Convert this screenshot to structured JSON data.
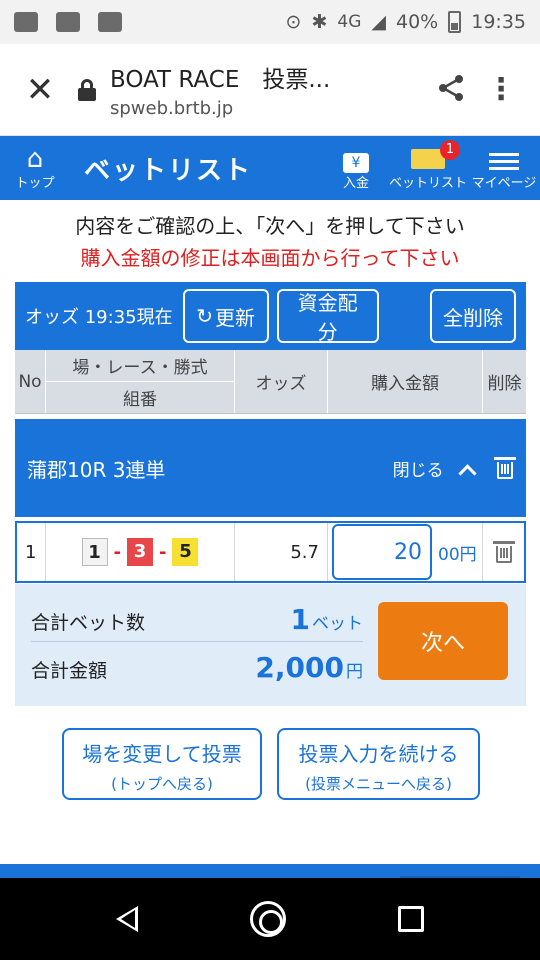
{
  "status_bar": {
    "network": "4G",
    "battery": "40%",
    "time": "19:35"
  },
  "browser": {
    "title": "BOAT RACE　投票...",
    "host": "spweb.brtb.jp",
    "close_icon": "close-icon",
    "share_icon": "share-icon",
    "more_icon": "more-vert-icon"
  },
  "header": {
    "home_label": "トップ",
    "title": "ベットリスト",
    "nav": {
      "deposit": "入金",
      "betlist": "ベットリスト",
      "mypage": "マイページ"
    },
    "badge": "1",
    "accent": "#1a73d8"
  },
  "notices": {
    "line1": "内容をご確認の上、「次へ」を押して下さい",
    "line2": "購入金額の修正は本画面から行って下さい"
  },
  "odds_bar": {
    "label": "オッズ 19:35現在",
    "refresh": "更新",
    "allocate": "資金配分",
    "clear_all": "全削除"
  },
  "table": {
    "headers": {
      "no": "No",
      "venue_line1": "場・レース・勝式",
      "venue_line2": "組番",
      "odds": "オッズ",
      "amount": "購入金額",
      "delete": "削除"
    },
    "race": {
      "name": "蒲郡10R 3連単",
      "close": "閉じる"
    },
    "rows": [
      {
        "no": "1",
        "combo": [
          "1",
          "3",
          "5"
        ],
        "odds": "5.7",
        "amount": "20",
        "unit": "00円"
      }
    ]
  },
  "summary": {
    "bets_label": "合計ベット数",
    "bets_value": "1",
    "bets_unit": "ベット",
    "total_label": "合計金額",
    "total_value": "2,000",
    "total_unit": "円",
    "next": "次へ",
    "next_color": "#ec7c12"
  },
  "bottom_buttons": {
    "change_main": "場を変更して投票",
    "change_sub": "(トップへ戻る)",
    "continue_main": "投票入力を続ける",
    "continue_sub": "(投票メニューへ戻る)"
  }
}
